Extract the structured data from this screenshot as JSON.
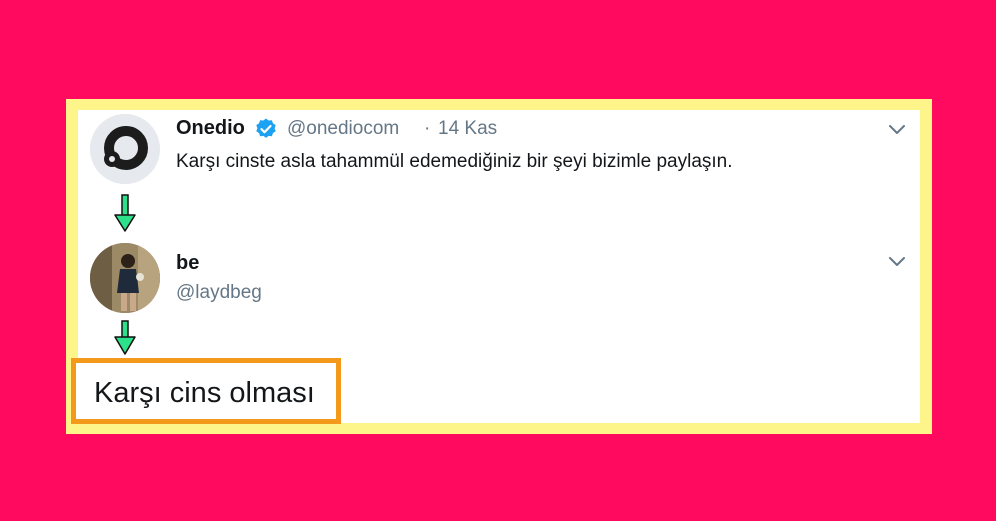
{
  "tweet1": {
    "name": "Onedio",
    "handle": "@onediocom",
    "separator": "·",
    "date": "14 Kas",
    "text": "Karşı cinste asla tahammül edemediğiniz bir şeyi bizimle paylaşın.",
    "avatar_icon": "onedio-logo-icon",
    "verified_icon": "verified-badge-icon"
  },
  "tweet2": {
    "name": "be",
    "handle": "@laydbeg",
    "avatar_icon": "user-photo-avatar"
  },
  "reply_highlight": {
    "text": "Karşı cins olması"
  },
  "colors": {
    "background": "#ff0a5e",
    "frame": "#fdf58a",
    "arrow": "#2de08a",
    "highlight_border": "#f39a1c",
    "verified": "#1da1f2",
    "handle": "#657786"
  }
}
